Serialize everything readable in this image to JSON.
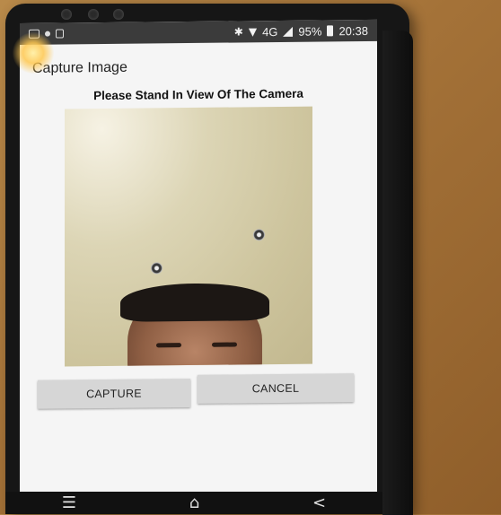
{
  "status_bar": {
    "network": "4G",
    "battery": "95%",
    "time": "20:38",
    "icons": [
      "gallery-icon",
      "notification-icon",
      "clipboard-icon",
      "bluetooth-icon",
      "wifi-icon",
      "signal-icon",
      "battery-icon"
    ]
  },
  "app": {
    "title": "Capture Image",
    "instruction": "Please Stand In View Of The Camera"
  },
  "buttons": {
    "capture_label": "CAPTURE",
    "cancel_label": "CANCEL"
  },
  "nav": {
    "menu_glyph": "☰",
    "home_glyph": "⌂",
    "back_glyph": "<"
  },
  "colors": {
    "screen_bg": "#f5f5f5",
    "button_bg": "#d6d6d6",
    "status_bar_bg": "#3b3b3b"
  }
}
